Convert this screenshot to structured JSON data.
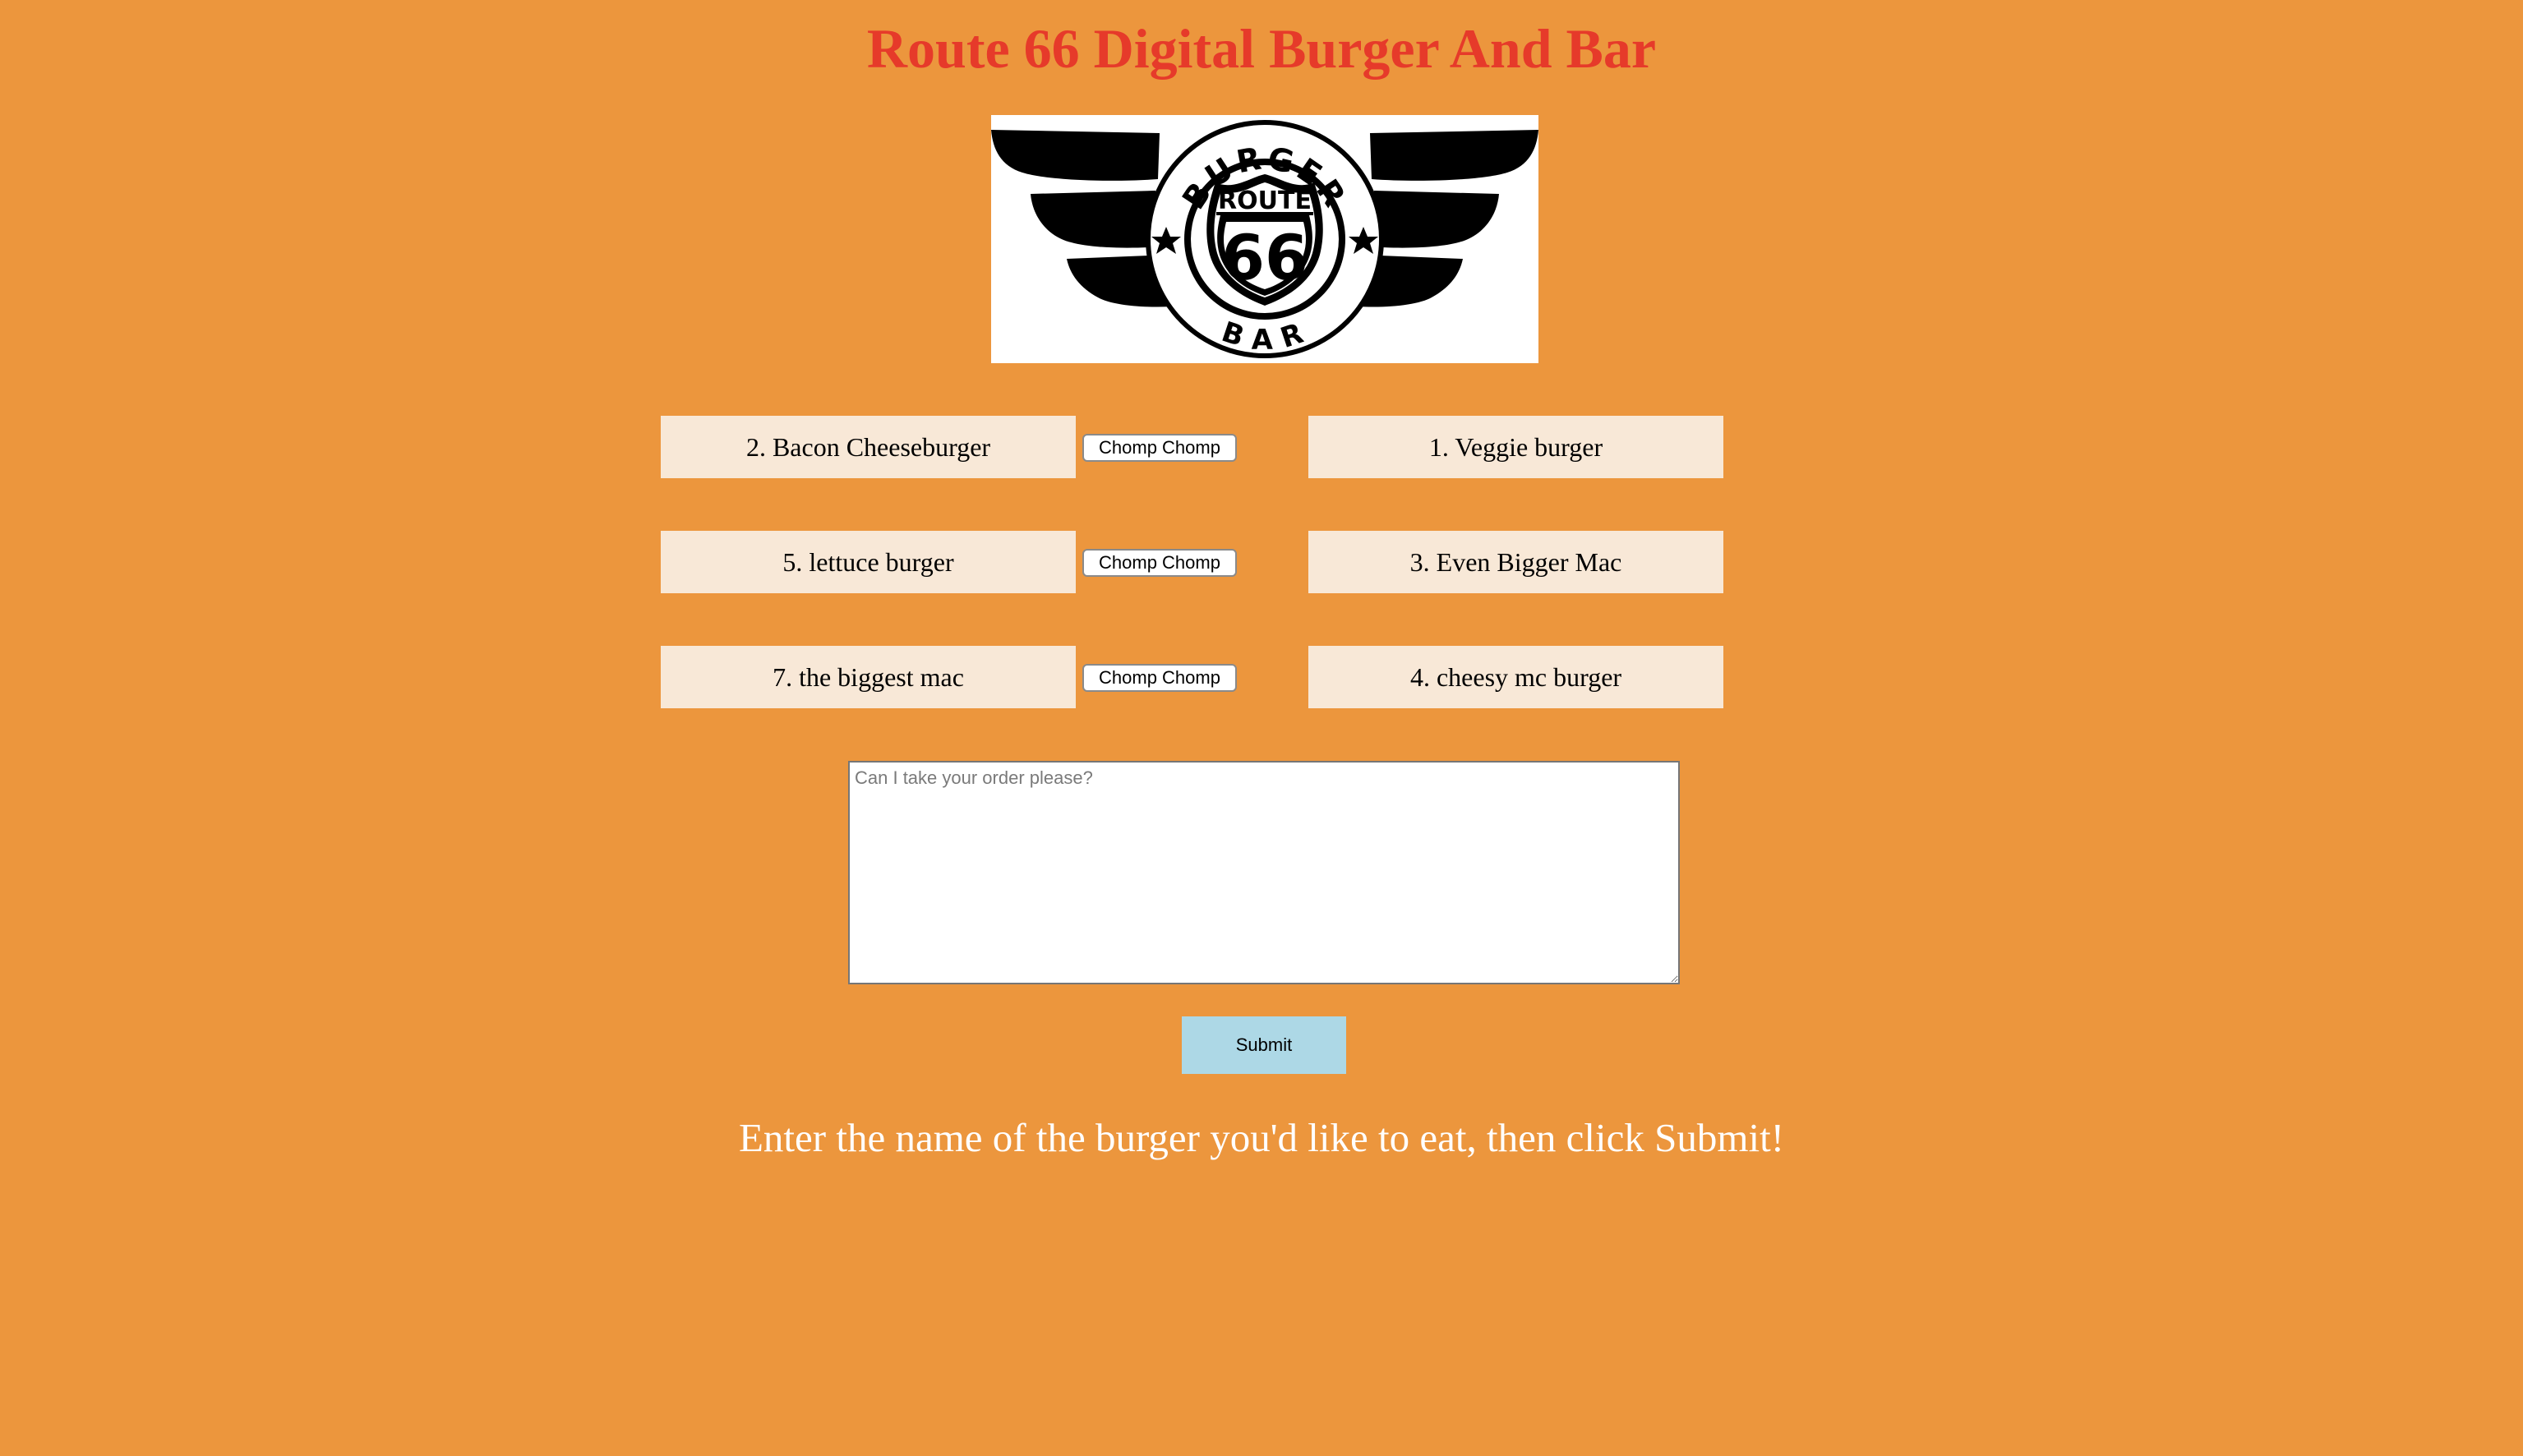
{
  "header": {
    "title": "Route 66 Digital Burger And Bar"
  },
  "logo": {
    "top_text": "BURGER",
    "shield_text": "ROUTE",
    "number": "66",
    "bottom_text": "BAR"
  },
  "menu": {
    "uneaten": [
      {
        "label": "2. Bacon Cheeseburger",
        "button_label": "Chomp Chomp"
      },
      {
        "label": "5. lettuce burger",
        "button_label": "Chomp Chomp"
      },
      {
        "label": "7. the biggest mac",
        "button_label": "Chomp Chomp"
      }
    ],
    "eaten": [
      {
        "label": "1. Veggie burger"
      },
      {
        "label": "3. Even Bigger Mac"
      },
      {
        "label": "4. cheesy mc burger"
      }
    ]
  },
  "order_form": {
    "placeholder": "Can I take your order please?",
    "submit_label": "Submit"
  },
  "instructions": "Enter the name of the burger you'd like to eat, then click Submit!",
  "colors": {
    "background": "#ec963d",
    "title": "#e63a2a",
    "burger_item_bg": "#f8e8d7",
    "submit_bg": "#add8e6",
    "instructions_text": "#ffffff"
  }
}
